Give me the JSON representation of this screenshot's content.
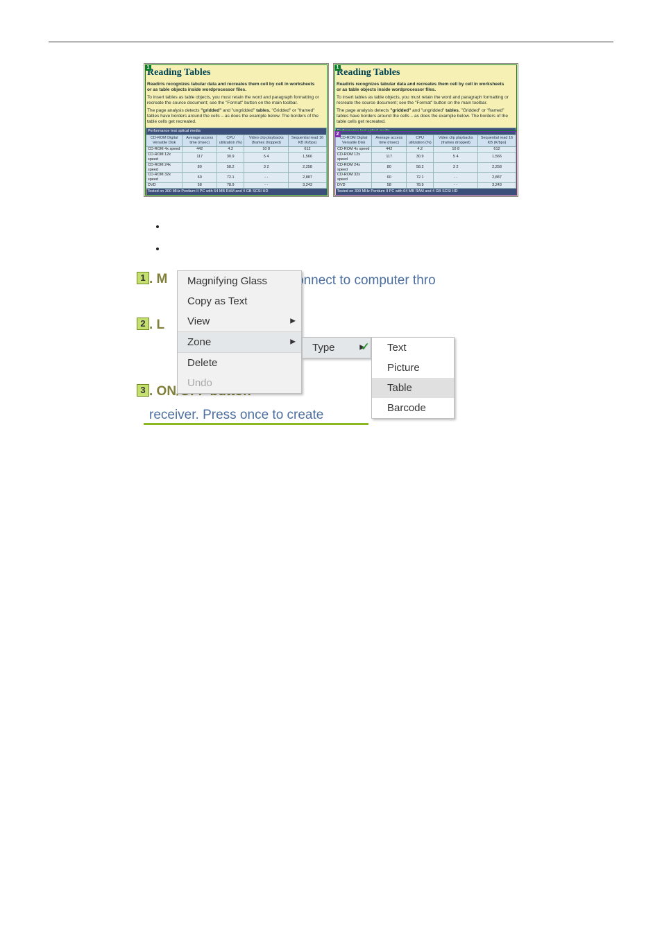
{
  "figure": {
    "title": "Reading Tables",
    "para1_a": "Readiris recognizes tabular data and recreates them cell by cell in worksheets",
    "para1_b": "or as table objects inside wordprocessor files.",
    "para2": "To insert tables as table objects, you must retain the word and paragraph formatting or recreate the source document; see the \"Format\" button on the main toolbar.",
    "para3_a": "The page analysis detects ",
    "para3_b": "\"gridded\"",
    "para3_c": " and \"ungridded\" ",
    "para3_d": "tables.",
    "para3_e": " \"Gridded\" or \"framed\" tables have borders around the cells – as does the example below. The borders of the table cells get recreated.",
    "table": {
      "caption": "Performance test optical media",
      "cols": [
        "CD-ROM\nDigital Versatile Disk",
        "Average access\ntime (msec)",
        "CPU\nutilization (%)",
        "Video clip\nplaybacks\n(frames\ndropped)",
        "Sequential\nread 16 KB\n(K/bps)"
      ],
      "rows": [
        [
          "CD-ROM 4x speed",
          "442",
          "4.2",
          "10   8",
          "612"
        ],
        [
          "CD-ROM 12x speed",
          "117",
          "30.9",
          "5    4",
          "1,566"
        ],
        [
          "CD-ROM 24x speed",
          "80",
          "58.2",
          "3    2",
          "2,258"
        ],
        [
          "CD-ROM 32x speed",
          "60",
          "72.1",
          "-    -",
          "2,887"
        ],
        [
          "DVD",
          "58",
          "78.9",
          "-    -",
          "3,243"
        ]
      ],
      "footer": "Tested on 300 MHz Pentium II PC with 64 MB RAM and 4 GB SCSI HD"
    },
    "zonesLeft": [
      "1"
    ],
    "zonesRight": [
      "1",
      "2"
    ]
  },
  "menuShot": {
    "bg_fragment_top_right": "onnect to computer thro",
    "bg_onoff": ". ON/OFF button –",
    "bg_receiver": "receiver.   Press once to create",
    "num1": "1",
    "bg_m1": ". M",
    "num2": "2",
    "bg_l2": ". L",
    "num3": "3",
    "ctxMenu": {
      "items": [
        {
          "label": "Magnifying Glass"
        },
        {
          "label": "Copy as Text"
        },
        {
          "label": "View",
          "sub": true
        },
        {
          "label": "Zone",
          "sub": true,
          "sep": true,
          "hi": true
        },
        {
          "label": "Delete",
          "sep": true
        },
        {
          "label": "Undo",
          "dis": true
        }
      ]
    },
    "subMenu": {
      "items": [
        {
          "label": "Type",
          "sub": true,
          "hi": true
        }
      ]
    },
    "typeMenu": {
      "items": [
        {
          "label": "Text",
          "check": true
        },
        {
          "label": "Picture"
        },
        {
          "label": "Table",
          "hi": true
        },
        {
          "label": "Barcode"
        }
      ]
    }
  }
}
